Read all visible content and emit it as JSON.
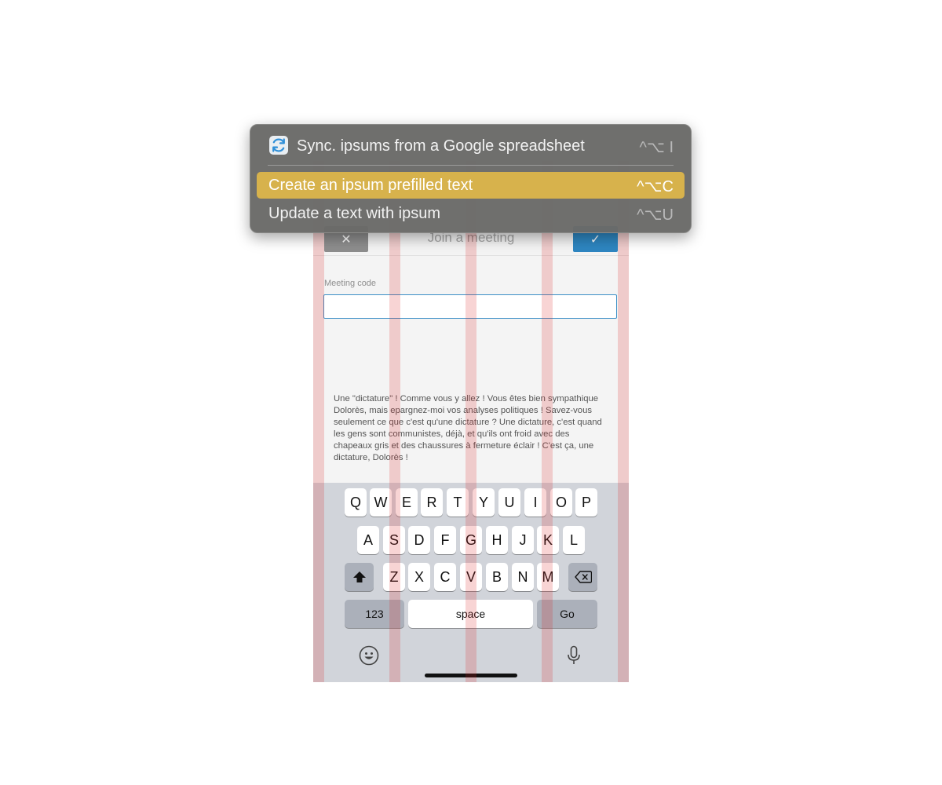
{
  "menu": {
    "items": [
      {
        "label": "Sync. ipsums from a Google spreadsheet",
        "shortcut": "^⌥ I",
        "icon": "sync-icon",
        "highlighted": false
      },
      {
        "label": "Create an ipsum prefilled text",
        "shortcut": "^⌥C",
        "highlighted": true
      },
      {
        "label": "Update a text with ipsum",
        "shortcut": "^⌥U",
        "highlighted": false
      }
    ],
    "highlight_color": "#d7b24c"
  },
  "phone": {
    "nav": {
      "cancel_icon": "✕",
      "title": "Join a meeting",
      "confirm_icon": "✓"
    },
    "form": {
      "label": "Meeting code",
      "value": ""
    },
    "body_text": "Une \"dictature\" ! Comme vous y allez ! Vous êtes bien sympathique Dolorès, mais epargnez-moi vos analyses politiques ! Savez-vous seulement ce que c'est qu'une dictature ? Une dictature, c'est quand les gens sont communistes, déjà, et qu'ils ont froid avec des chapeaux gris et des chaussures à fermeture éclair ! C'est ça, une dictature, Dolorès !"
  },
  "keyboard": {
    "row1": [
      "Q",
      "W",
      "E",
      "R",
      "T",
      "Y",
      "U",
      "I",
      "O",
      "P"
    ],
    "row2": [
      "A",
      "S",
      "D",
      "F",
      "G",
      "H",
      "J",
      "K",
      "L"
    ],
    "row3": [
      "Z",
      "X",
      "C",
      "V",
      "B",
      "N",
      "M"
    ],
    "numbers_key": "123",
    "space_key": "space",
    "go_key": "Go",
    "icons": [
      "shift-icon",
      "backspace-icon",
      "emoji-icon",
      "microphone-icon"
    ]
  },
  "colors": {
    "accent_blue": "#2e86c1",
    "guide_red": "#de2828"
  }
}
